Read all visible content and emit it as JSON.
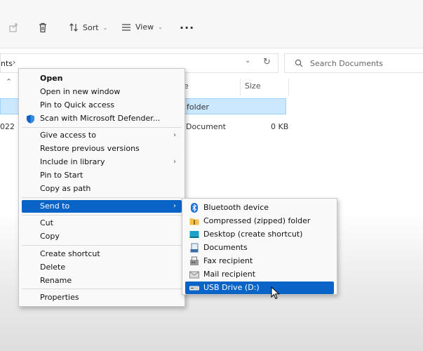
{
  "toolbar": {
    "sort_label": "Sort",
    "view_label": "View"
  },
  "address": {
    "path_fragment": "nts",
    "search_placeholder": "Search Documents"
  },
  "headers": {
    "name_fragment": "e",
    "size": "Size"
  },
  "files": [
    {
      "name_fragment": "folder",
      "size": ""
    },
    {
      "date_fragment": "022",
      "name_fragment": "Document",
      "size": "0 KB"
    }
  ],
  "context_menu": {
    "items": [
      {
        "label": "Open"
      },
      {
        "label": "Open in new window"
      },
      {
        "label": "Pin to Quick access"
      },
      {
        "label": "Scan with Microsoft Defender..."
      },
      {
        "label": "Give access to"
      },
      {
        "label": "Restore previous versions"
      },
      {
        "label": "Include in library"
      },
      {
        "label": "Pin to Start"
      },
      {
        "label": "Copy as path"
      },
      {
        "label": "Send to"
      },
      {
        "label": "Cut"
      },
      {
        "label": "Copy"
      },
      {
        "label": "Create shortcut"
      },
      {
        "label": "Delete"
      },
      {
        "label": "Rename"
      },
      {
        "label": "Properties"
      }
    ]
  },
  "send_to_menu": {
    "items": [
      {
        "label": "Bluetooth device"
      },
      {
        "label": "Compressed (zipped) folder"
      },
      {
        "label": "Desktop (create shortcut)"
      },
      {
        "label": "Documents"
      },
      {
        "label": "Fax recipient"
      },
      {
        "label": "Mail recipient"
      },
      {
        "label": "USB Drive (D:)"
      }
    ]
  },
  "colors": {
    "selection_blue": "#0a64c8",
    "row_highlight": "#cce8ff"
  }
}
